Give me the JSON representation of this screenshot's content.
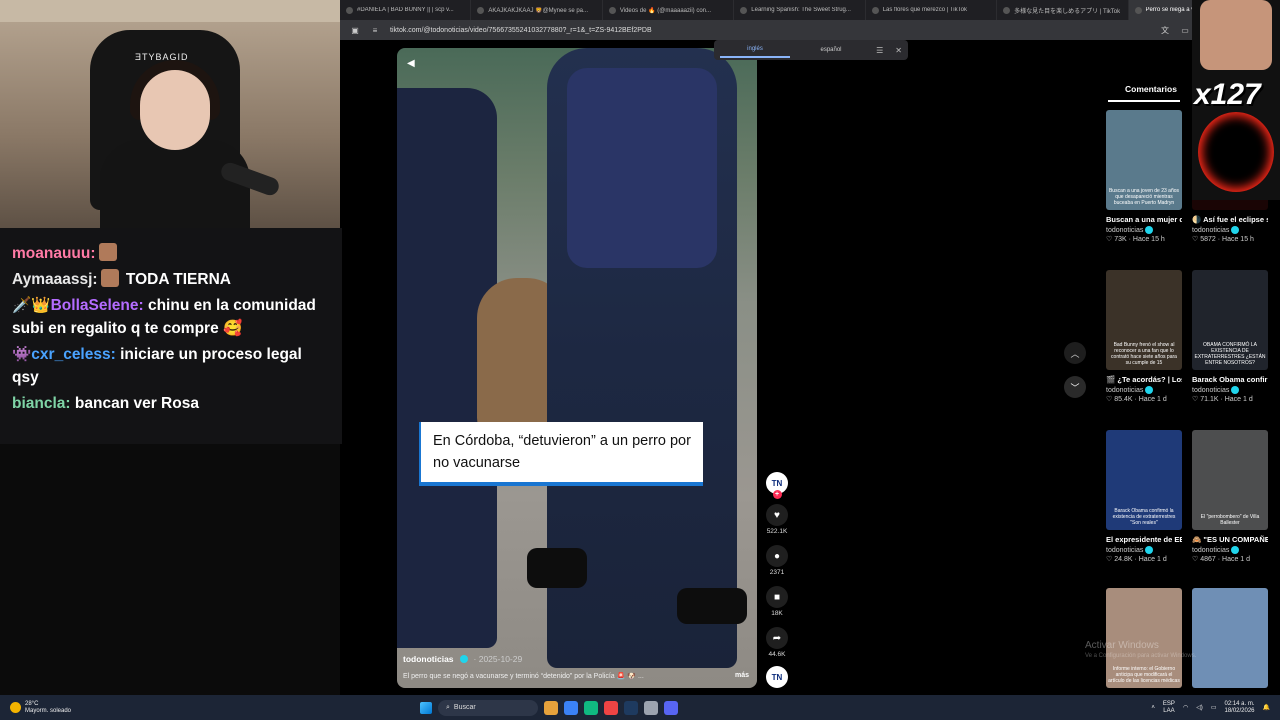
{
  "browser": {
    "tabs": [
      {
        "label": "#DANIELA | BAD BUNNY || | scp v..."
      },
      {
        "label": "AKAJKAKJKAAJ 🦁@Mynee se pa..."
      },
      {
        "label": "Videos de 🔥 (@maaaaazii) con..."
      },
      {
        "label": "Learning Spanish: The Sweet Strug..."
      },
      {
        "label": "Las flores que merezco | TikTok"
      },
      {
        "label": "多様な見た目を楽しめるアプリ | TikTok"
      },
      {
        "label": "Perro se niega a vacunarse",
        "active": true
      }
    ],
    "url": "tiktok.com/@todonoticias/video/7566735524103277880?_r=1&_t=ZS-9412BEf2PDB"
  },
  "translate_popup": {
    "from_lang": "inglés",
    "to_lang": "español"
  },
  "video": {
    "caption": "En Córdoba, “detuvieron” a un perro por no vacunarse",
    "author": "todonoticias",
    "date": "· 2025-10-29",
    "description": "El perro que se negó a vacunarse y terminó “detenido” por la Policía 🚨 🐶 ...",
    "more_label": "más",
    "channel_avatar_text": "TN",
    "likes": "522.1K",
    "comments": "2371",
    "saves": "18K",
    "shares": "44.6K"
  },
  "side_panel": {
    "tab_label": "Comentarios",
    "cards": [
      {
        "title": "Buscan a una mujer de Villa...",
        "author": "todonoticias",
        "stats": "♡ 73K · Hace 15 h",
        "thumb_caption": "Buscan a una joven de 23 años que desapareció mientras buceaba en Puerto Madryn",
        "color": "#5a7a8c"
      },
      {
        "title": "🌗 Así fue el eclipse solar...",
        "author": "todonoticias",
        "stats": "♡ 5872 · Hace 15 h",
        "thumb_caption": "",
        "color": "#1a0505"
      },
      {
        "title": "🎬 ¿Te acordás? | Los shows de Ba...",
        "author": "todonoticias",
        "stats": "♡ 85.4K · Hace 1 d",
        "thumb_caption": "Bad Bunny frenó el show al reconocer a una fan que lo contrató hace siete años para su cumple de 15",
        "color": "#3b3228"
      },
      {
        "title": "Barack Obama confirmó la...",
        "author": "todonoticias",
        "stats": "♡ 71.1K · Hace 1 d",
        "thumb_caption": "OBAMA CONFIRMÓ LA EXISTENCIA DE EXTRATERRESTRES ¿ESTÁN ENTRE NOSOTROS?",
        "color": "#20242c"
      },
      {
        "title": "El expresidente de EE.UU. Barack...",
        "author": "todonoticias",
        "stats": "♡ 24.8K · Hace 1 d",
        "thumb_caption": "Barack Obama confirmó la existencia de extraterrestres \"Son reales\"",
        "color": "#1f3a78"
      },
      {
        "title": "🙈 \"ES UN COMPAÑERO...",
        "author": "todonoticias",
        "stats": "♡ 4867 · Hace 1 d",
        "thumb_caption": "El \"perrobombero\" de Villa Ballester",
        "color": "#4d4e4f"
      },
      {
        "title": "",
        "author": "",
        "stats": "",
        "thumb_caption": "Informe interno: el Gobierno anticipa que modificará el artículo de las licencias médicas",
        "color": "#a88d7c"
      },
      {
        "title": "",
        "author": "",
        "stats": "",
        "thumb_caption": "",
        "color": "#6f8fb5"
      }
    ]
  },
  "stream_overlay": {
    "chair_brand": "ƎTYBAGID",
    "chat": [
      {
        "user": "moanauuu:",
        "color": "#ff7aa5",
        "message": ""
      },
      {
        "user": "Aymaaassj:",
        "color": "#e8e8e8",
        "message": "TODA TIERNA"
      },
      {
        "user": "🗡️👑BollaSelene:",
        "color": "#b46cff",
        "message": "chinu en la comunidad subi en regalito q te compre 🥰"
      },
      {
        "user": "👾cxr_celess:",
        "color": "#4aa3ff",
        "message": "iniciare un proceso legal qsy"
      },
      {
        "user": "biancla:",
        "color": "#7fd4a6",
        "message": "bancan ver Rosa"
      }
    ],
    "gif_counter": "x127"
  },
  "windows_watermark": {
    "line1": "Activar Windows",
    "line2": "Ve a Configuración para activar Windows."
  },
  "taskbar": {
    "temperature": "28°C",
    "weather": "Mayorm. soleado",
    "search_placeholder": "Buscar",
    "lang_line1": "ESP",
    "lang_line2": "LAA",
    "time": "02:14 a. m.",
    "date": "18/02/2026"
  }
}
